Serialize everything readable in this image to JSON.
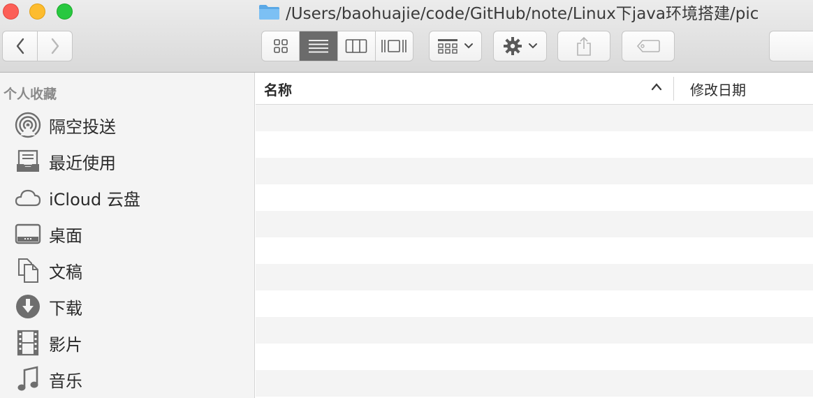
{
  "window": {
    "path": "/Users/baohuajie/code/GitHub/note/Linux下java环境搭建/pic",
    "folder_icon": "folder-icon"
  },
  "toolbar": {
    "back_icon": "chevron-left-icon",
    "forward_icon": "chevron-right-icon",
    "view_modes": [
      "icon-view",
      "list-view",
      "column-view",
      "cover-flow-view"
    ],
    "active_view": "list-view",
    "group_icon": "arrange-icon",
    "action_icon": "gear-icon",
    "share_icon": "share-icon",
    "tag_icon": "tag-icon"
  },
  "sidebar": {
    "section_title": "个人收藏",
    "items": [
      {
        "label": "隔空投送",
        "icon": "airdrop-icon"
      },
      {
        "label": "最近使用",
        "icon": "recents-icon"
      },
      {
        "label": "iCloud 云盘",
        "icon": "cloud-icon"
      },
      {
        "label": "桌面",
        "icon": "desktop-icon"
      },
      {
        "label": "文稿",
        "icon": "documents-icon"
      },
      {
        "label": "下载",
        "icon": "download-icon"
      },
      {
        "label": "影片",
        "icon": "movie-icon"
      },
      {
        "label": "音乐",
        "icon": "music-icon"
      }
    ]
  },
  "file_list": {
    "columns": [
      "名称",
      "修改日期"
    ],
    "sort_icon": "sort-ascending-icon",
    "rows": []
  },
  "colors": {
    "close": "#fc5f57",
    "minimize": "#fdbc2e",
    "maximize": "#28c840",
    "folder": "#5aa8e6",
    "row_alt": "#f4f4f4"
  }
}
